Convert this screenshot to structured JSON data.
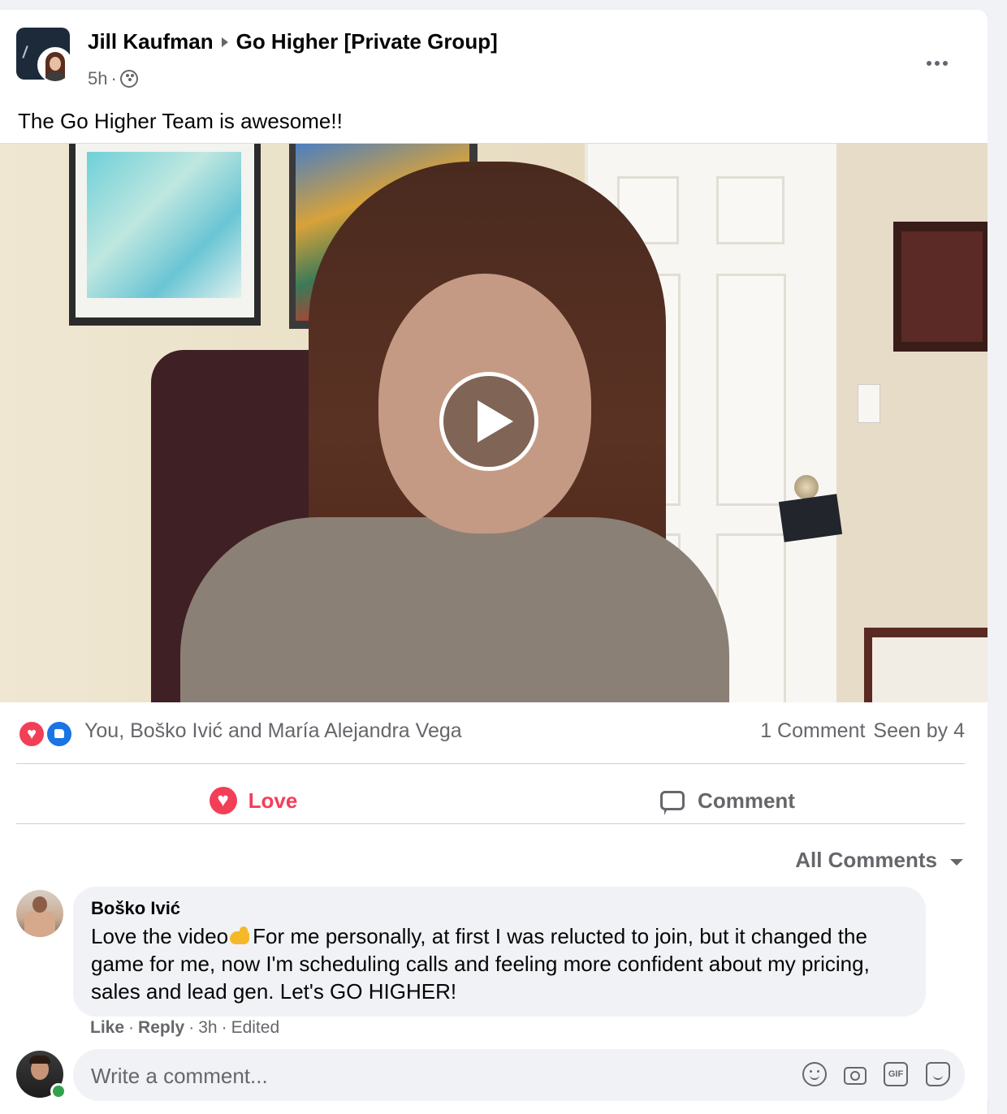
{
  "post": {
    "author": "Jill Kaufman",
    "group": "Go Higher [Private Group]",
    "time": "5h",
    "separator": "·",
    "privacy_icon": "group-privacy-icon",
    "more_icon": "more-options-icon",
    "text": "The Go Higher Team is awesome!!"
  },
  "video": {
    "play_icon": "play-icon"
  },
  "reactions": {
    "icons": [
      "love-reaction-icon",
      "like-reaction-icon"
    ],
    "names": "You, Boško Ivić and María Alejandra Vega",
    "comments": "1 Comment",
    "seen": "Seen by 4"
  },
  "actions": {
    "love_label": "Love",
    "comment_label": "Comment"
  },
  "comments_filter": "All Comments",
  "comment": {
    "author": "Boško Ivić",
    "text_before": "Love the video",
    "emoji": "flexed-biceps-emoji",
    "text_after": "For me personally, at first I was relucted to join, but it changed the game for me, now I'm scheduling calls and feeling more confident about my pricing, sales and lead gen. Let's GO HIGHER!",
    "like": "Like",
    "reply": "Reply",
    "time": "3h",
    "edited": "Edited",
    "sep": "·"
  },
  "composer": {
    "placeholder": "Write a comment...",
    "tools": [
      "emoji-icon",
      "camera-icon",
      "gif-icon",
      "sticker-icon"
    ],
    "gif_label": "GIF"
  },
  "colors": {
    "love": "#f33e58",
    "like": "#1b74e4",
    "secondary_text": "#65676b",
    "online": "#31a24c"
  }
}
